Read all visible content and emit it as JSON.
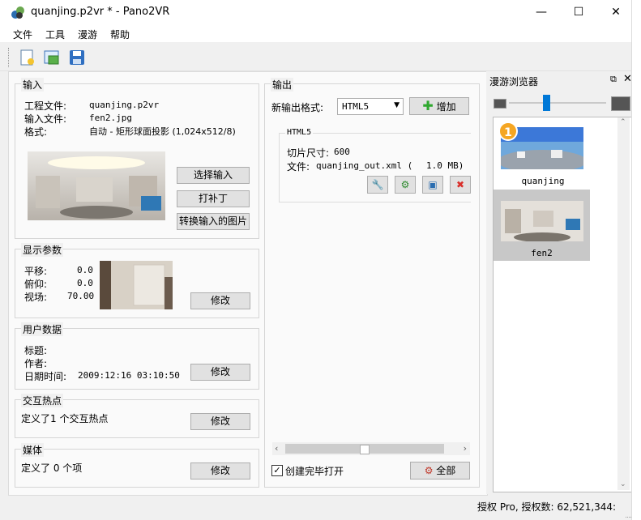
{
  "window": {
    "title": "quanjing.p2vr * - Pano2VR",
    "minimize": "—",
    "maximize": "☐",
    "close": "✕"
  },
  "menu": {
    "items": [
      "文件",
      "工具",
      "漫游",
      "帮助"
    ]
  },
  "input_group": {
    "title": "输入",
    "project_file_label": "工程文件:",
    "project_file_value": "quanjing.p2vr",
    "input_file_label": "输入文件:",
    "input_file_value": "fen2.jpg",
    "format_label": "格式:",
    "format_value": "自动 - 矩形球面投影 (1,024x512/8)",
    "select_input_button": "选择输入",
    "patch_button": "打补丁",
    "convert_button": "转换输入的图片"
  },
  "display_group": {
    "title": "显示参数",
    "pan_label": "平移:",
    "pan_value": "0.0",
    "tilt_label": "俯仰:",
    "tilt_value": "0.0",
    "fov_label": "视场:",
    "fov_value": "70.00",
    "modify_button": "修改"
  },
  "user_data_group": {
    "title": "用户数据",
    "title_label": "标题:",
    "author_label": "作者:",
    "datetime_label": "日期时间:",
    "datetime_value": "2009:12:16 03:10:50",
    "modify_button": "修改"
  },
  "hotspot_group": {
    "title": "交互热点",
    "text": "定义了1 个交互热点",
    "modify_button": "修改"
  },
  "media_group": {
    "title": "媒体",
    "text": "定义了 0 个项",
    "modify_button": "修改"
  },
  "output_group": {
    "title": "输出",
    "new_format_label": "新输出格式:",
    "format_selected": "HTML5",
    "add_button": "增加",
    "html5": {
      "title": "HTML5",
      "tile_size_label": "切片尺寸:",
      "tile_size_value": "600",
      "file_label": "文件:",
      "file_value": "quanjing_out.xml (",
      "file_size": "1.0 MB)"
    },
    "open_after_create_label": "创建完毕打开",
    "all_button": "全部"
  },
  "tour_browser": {
    "title": "漫游浏览器",
    "items": [
      {
        "label": "quanjing",
        "badge": "1"
      },
      {
        "label": "fen2"
      }
    ],
    "slider_level": 0.38
  },
  "status": {
    "text": "授权 Pro, 授权数: 62,521,344:"
  },
  "colors": {
    "accent": "#0078d7",
    "selected_bg": "#c8c8c8",
    "badge": "#f5a623"
  }
}
